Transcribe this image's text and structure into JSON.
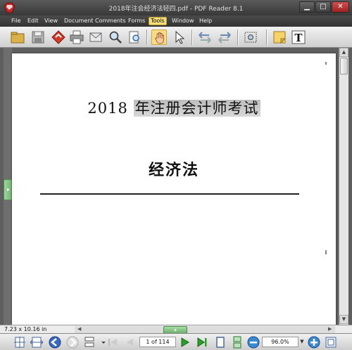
{
  "window": {
    "title": "2018年注会经济法轻四.pdf - PDF Reader 8.1",
    "min_glyph": "▁",
    "max_glyph": "□",
    "close_glyph": "✕"
  },
  "menu": {
    "items": [
      {
        "label": "File"
      },
      {
        "label": "Edit"
      },
      {
        "label": "View"
      },
      {
        "label": "Document"
      },
      {
        "label": "Comments"
      },
      {
        "label": "Forms"
      },
      {
        "label": "Tools"
      },
      {
        "label": "Window"
      },
      {
        "label": "Help"
      }
    ],
    "active": "Tools"
  },
  "toolbar": {
    "icons": [
      "open-folder-icon",
      "save-icon",
      "sign-icon",
      "print-icon",
      "email-icon",
      "search-icon",
      "find-file-icon",
      "hand-tool-icon",
      "select-arrow-icon",
      "prev-view-icon",
      "next-view-icon",
      "snapshot-icon",
      "sticky-note-icon",
      "typewriter-icon"
    ],
    "active_tool": "hand-tool-icon",
    "typewriter_glyph": "T"
  },
  "document": {
    "title_year": "2018",
    "title_text": "年注册会计师考试",
    "subtitle": "经济法",
    "page_size": "7.23 x 10.16 in"
  },
  "navigation": {
    "page_display": "1 of 114",
    "zoom": "96.0%"
  },
  "colors": {
    "accent": "#f7e07a",
    "handle_green": "#6cb06c",
    "chrome_dark": "#3a3a3a"
  }
}
